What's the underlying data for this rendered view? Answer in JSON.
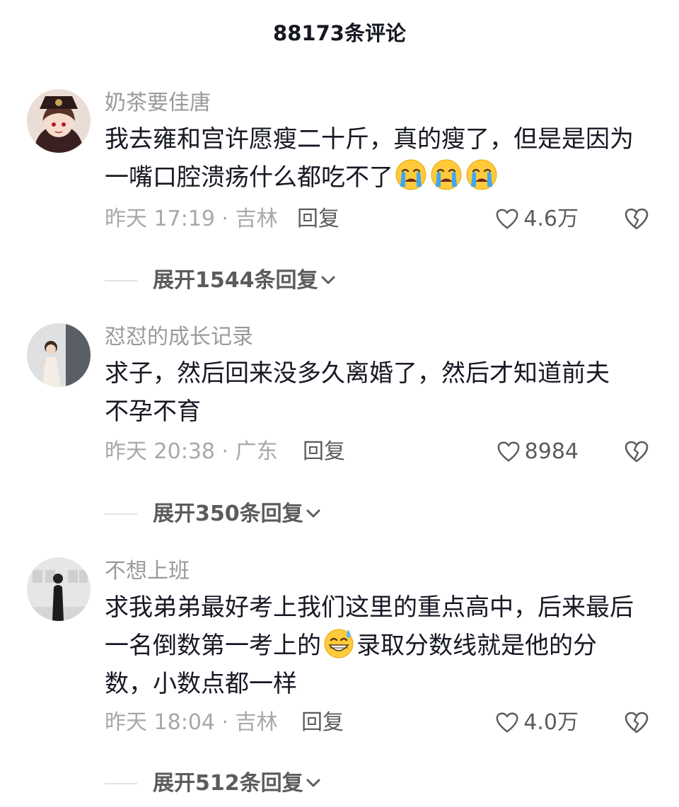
{
  "header": {
    "title": "88173条评论"
  },
  "comments": [
    {
      "username": "奶茶要佳唐",
      "text_parts": [
        "我去雍和宫许愿瘦二十斤，真的瘦了，但是是因为一嘴口腔溃疡什么都吃不了",
        ""
      ],
      "emojis": [
        "loudly-crying-face-emoji",
        "loudly-crying-face-emoji",
        "loudly-crying-face-emoji"
      ],
      "time_location": "昨天 17:19 · 吉林",
      "reply_label": "回复",
      "likes": "4.6万",
      "expand_label": "展开1544条回复"
    },
    {
      "username": "怼怼的成长记录",
      "text_parts": [
        "求子，然后回来没多久离婚了，然后才知道前夫不孕不育",
        ""
      ],
      "emojis": [],
      "time_location": "昨天 20:38 · 广东",
      "reply_label": "回复",
      "likes": "8984",
      "expand_label": "展开350条回复"
    },
    {
      "username": "不想上班",
      "text_parts": [
        "求我弟弟最好考上我们这里的重点高中，后来最后一名倒数第一考上的",
        "录取分数线就是他的分数，小数点都一样"
      ],
      "emojis": [
        "grinning-face-with-sweat-emoji"
      ],
      "time_location": "昨天 18:04 · 吉林",
      "reply_label": "回复",
      "likes": "4.0万",
      "expand_label": "展开512条回复"
    }
  ],
  "icons": {
    "like": "heart-outline-icon",
    "dislike": "broken-heart-icon",
    "expand": "chevron-down-icon"
  },
  "colors": {
    "text": "#161823",
    "secondary": "#9a9a9a",
    "action": "#5c5c5c",
    "divider": "#e2e2e2"
  }
}
